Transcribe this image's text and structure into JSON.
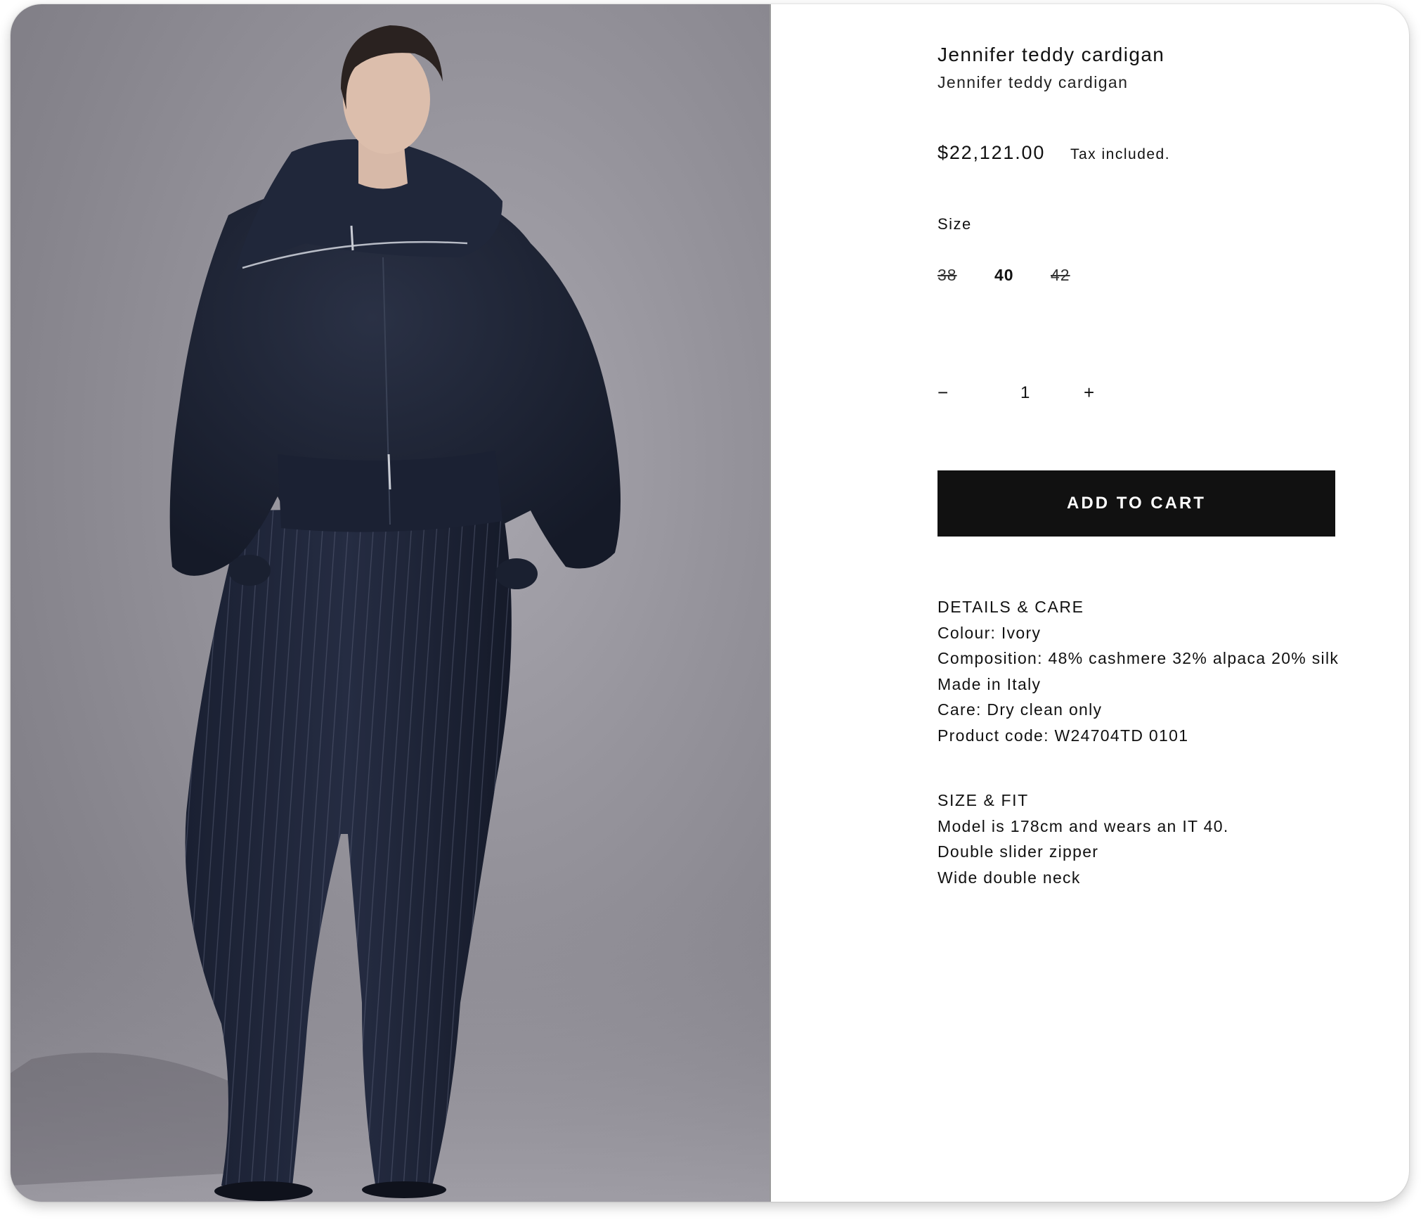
{
  "product": {
    "title": "Jennifer teddy cardigan",
    "subtitle": "Jennifer teddy cardigan",
    "price": "$22,121.00",
    "tax_note": "Tax included."
  },
  "size": {
    "label": "Size",
    "options": [
      {
        "label": "38",
        "available": false,
        "selected": false
      },
      {
        "label": "40",
        "available": true,
        "selected": true
      },
      {
        "label": "42",
        "available": false,
        "selected": false
      }
    ]
  },
  "quantity": {
    "minus": "−",
    "value": "1",
    "plus": "+"
  },
  "cart": {
    "button_label": "ADD TO CART"
  },
  "details_care": {
    "heading": "DETAILS & CARE",
    "lines": [
      "Colour: Ivory",
      "Composition: 48% cashmere 32% alpaca 20% silk",
      "Made in Italy",
      "Care: Dry clean only",
      "Product code: W24704TD 0101"
    ]
  },
  "size_fit": {
    "heading": "SIZE & FIT",
    "lines": [
      "Model is 178cm and wears an IT 40.",
      "Double slider zipper",
      "Wide double neck"
    ]
  },
  "colors": {
    "button_bg": "#111111",
    "button_text": "#ffffff",
    "photo_bg": "#96949c",
    "garment": "#1c2233"
  }
}
